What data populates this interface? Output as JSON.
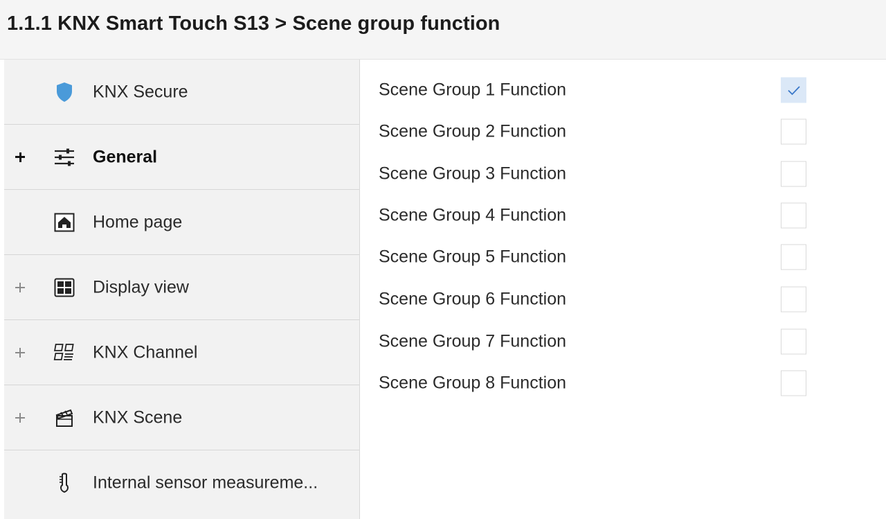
{
  "header": {
    "title": "1.1.1 KNX Smart Touch S13 > Scene group function"
  },
  "sidebar": {
    "items": [
      {
        "label": "KNX Secure",
        "icon": "shield-icon",
        "expandable": false,
        "bold": false
      },
      {
        "label": "General",
        "icon": "sliders-icon",
        "expandable": true,
        "bold": true
      },
      {
        "label": "Home page",
        "icon": "home-icon",
        "expandable": false,
        "bold": false
      },
      {
        "label": "Display view",
        "icon": "display-grid-icon",
        "expandable": true,
        "bold": false
      },
      {
        "label": "KNX Channel",
        "icon": "channel-icon",
        "expandable": true,
        "bold": false
      },
      {
        "label": "KNX Scene",
        "icon": "clapperboard-icon",
        "expandable": true,
        "bold": false
      },
      {
        "label": "Internal sensor measureme...",
        "icon": "thermometer-icon",
        "expandable": false,
        "bold": false
      }
    ]
  },
  "main": {
    "rows": [
      {
        "label": "Scene Group 1 Function",
        "checked": true
      },
      {
        "label": "Scene Group 2 Function",
        "checked": false
      },
      {
        "label": "Scene Group 3 Function",
        "checked": false
      },
      {
        "label": "Scene Group 4 Function",
        "checked": false
      },
      {
        "label": "Scene Group 5 Function",
        "checked": false
      },
      {
        "label": "Scene Group 6 Function",
        "checked": false
      },
      {
        "label": "Scene Group 7 Function",
        "checked": false
      },
      {
        "label": "Scene Group 8 Function",
        "checked": false
      }
    ]
  },
  "colors": {
    "shield": "#4a9ad9",
    "checkbox_checked_bg": "#dbe8f7",
    "checkmark": "#3a78c9"
  }
}
